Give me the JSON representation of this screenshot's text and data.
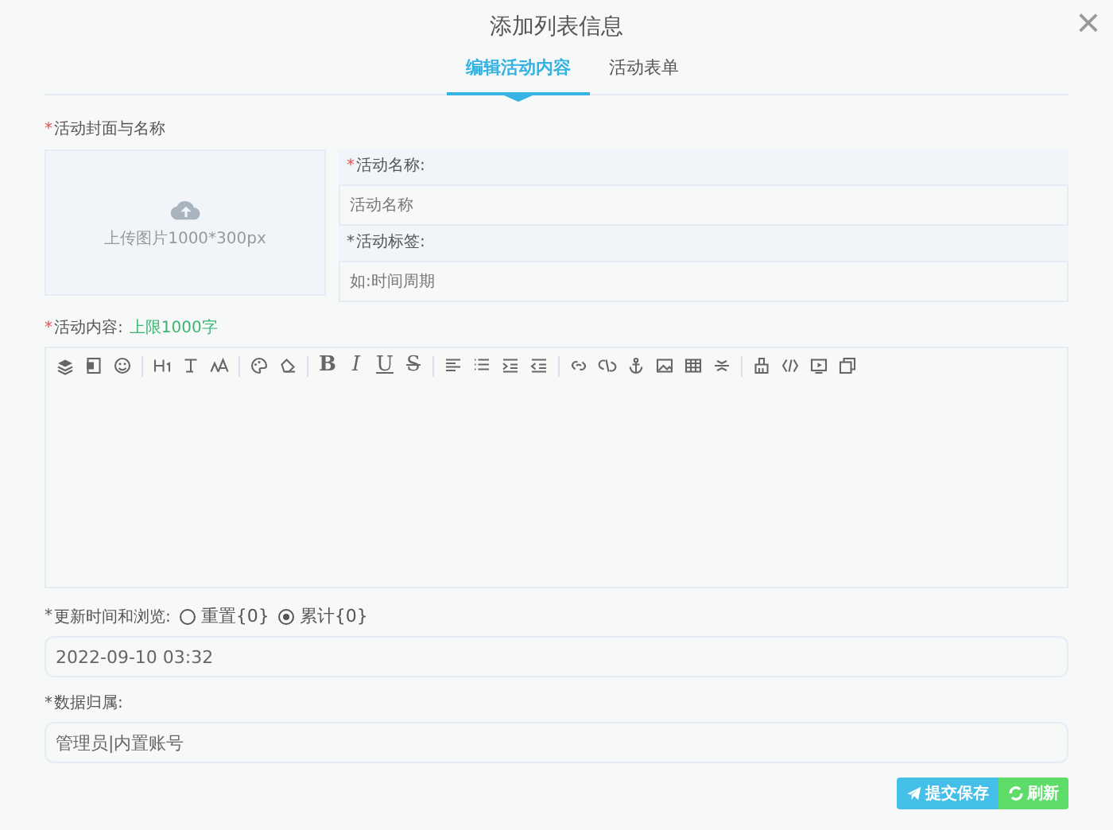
{
  "window": {
    "title": "添加列表信息",
    "close": "×"
  },
  "tabs": [
    {
      "label": "编辑活动内容",
      "selected": true
    },
    {
      "label": "活动表单",
      "selected": false
    }
  ],
  "cover_label": {
    "mark": "*",
    "color": "#e05050",
    "text": "活动封面与名称"
  },
  "upload": {
    "text": "上传图片1000*300px"
  },
  "name_field": {
    "label": {
      "mark": "*",
      "color": "#e05050",
      "text": "活动名称:"
    },
    "placeholder": "活动名称"
  },
  "tag_field": {
    "label": {
      "mark": "*",
      "color": "#555555",
      "text": "活动标签:"
    },
    "placeholder": "如:时间周期"
  },
  "content_label": {
    "mark": "*",
    "color": "#e05050",
    "text": "活动内容:",
    "hint": "上限1000字"
  },
  "toolbar_letters": [
    "B",
    "I",
    "U",
    "S"
  ],
  "update_label": {
    "mark": "*",
    "color": "#555555",
    "text": "更新时间和浏览:"
  },
  "update_options": [
    {
      "label": "重置{0}",
      "selected": false
    },
    {
      "label": "累计{0}",
      "selected": true
    }
  ],
  "time_field": {
    "value": "2022-09-10 03:32"
  },
  "owner_label": {
    "mark": "*",
    "color": "#555555",
    "text": "数据归属:"
  },
  "owner_field": {
    "value": "管理员|内置账号"
  },
  "buttons": [
    {
      "label": "提交保存",
      "kind": "submit"
    },
    {
      "label": "刷新",
      "kind": "refresh"
    }
  ]
}
